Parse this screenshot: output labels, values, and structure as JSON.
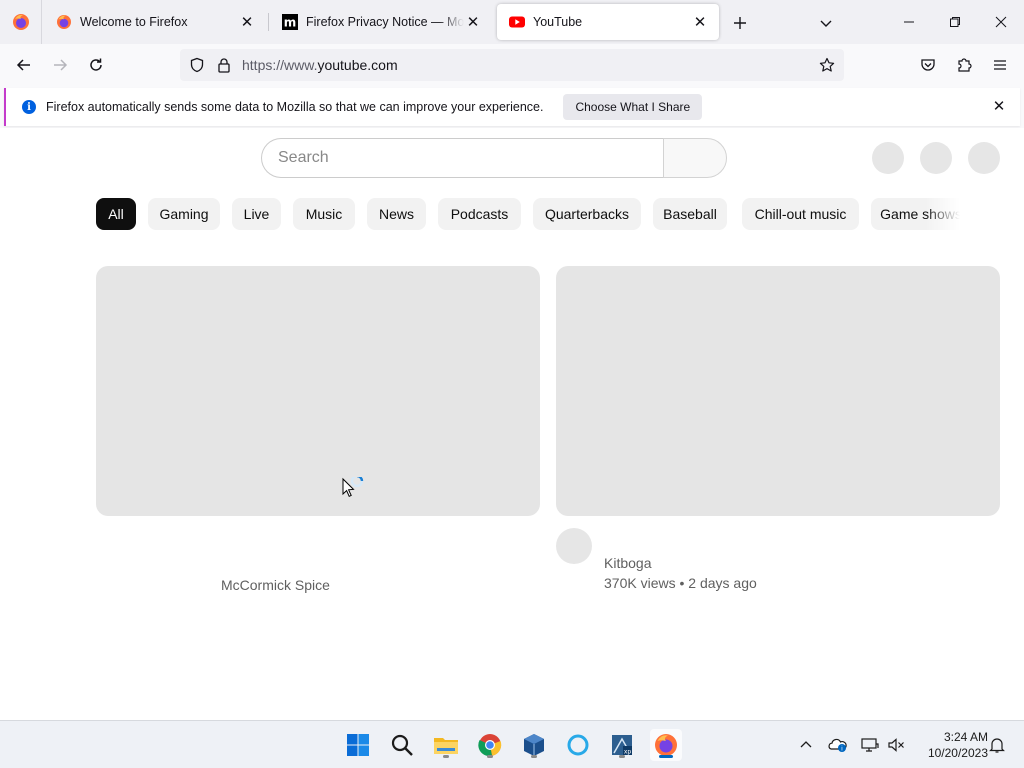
{
  "browser": {
    "tabs": [
      {
        "title": "Welcome to Firefox"
      },
      {
        "title": "Firefox Privacy Notice — Mozilla"
      },
      {
        "title": "YouTube"
      }
    ],
    "url_prefix": "https://www.",
    "url_domain": "youtube.com"
  },
  "notification": {
    "message": "Firefox automatically sends some data to Mozilla so that we can improve your experience.",
    "button_label": "Choose What I Share"
  },
  "youtube": {
    "search_placeholder": "Search",
    "chips": [
      "All",
      "Gaming",
      "Live",
      "Music",
      "News",
      "Podcasts",
      "Quarterbacks",
      "Baseball",
      "Chill-out music",
      "Game shows"
    ],
    "videos": [
      {
        "channel": "McCormick Spice",
        "meta": ""
      },
      {
        "channel": "Kitboga",
        "meta": "370K views • 2 days ago"
      }
    ]
  },
  "taskbar": {
    "apps": [
      "start",
      "search",
      "file-explorer",
      "chrome",
      "virtualbox",
      "cortana",
      "xp-app",
      "firefox"
    ],
    "time": "3:24 AM",
    "date": "10/20/2023"
  },
  "colors": {
    "accent": "#0060df",
    "notification_border": "#c43bcb",
    "chip_active": "#0f0f0f",
    "youtube_red": "#ff0000"
  }
}
